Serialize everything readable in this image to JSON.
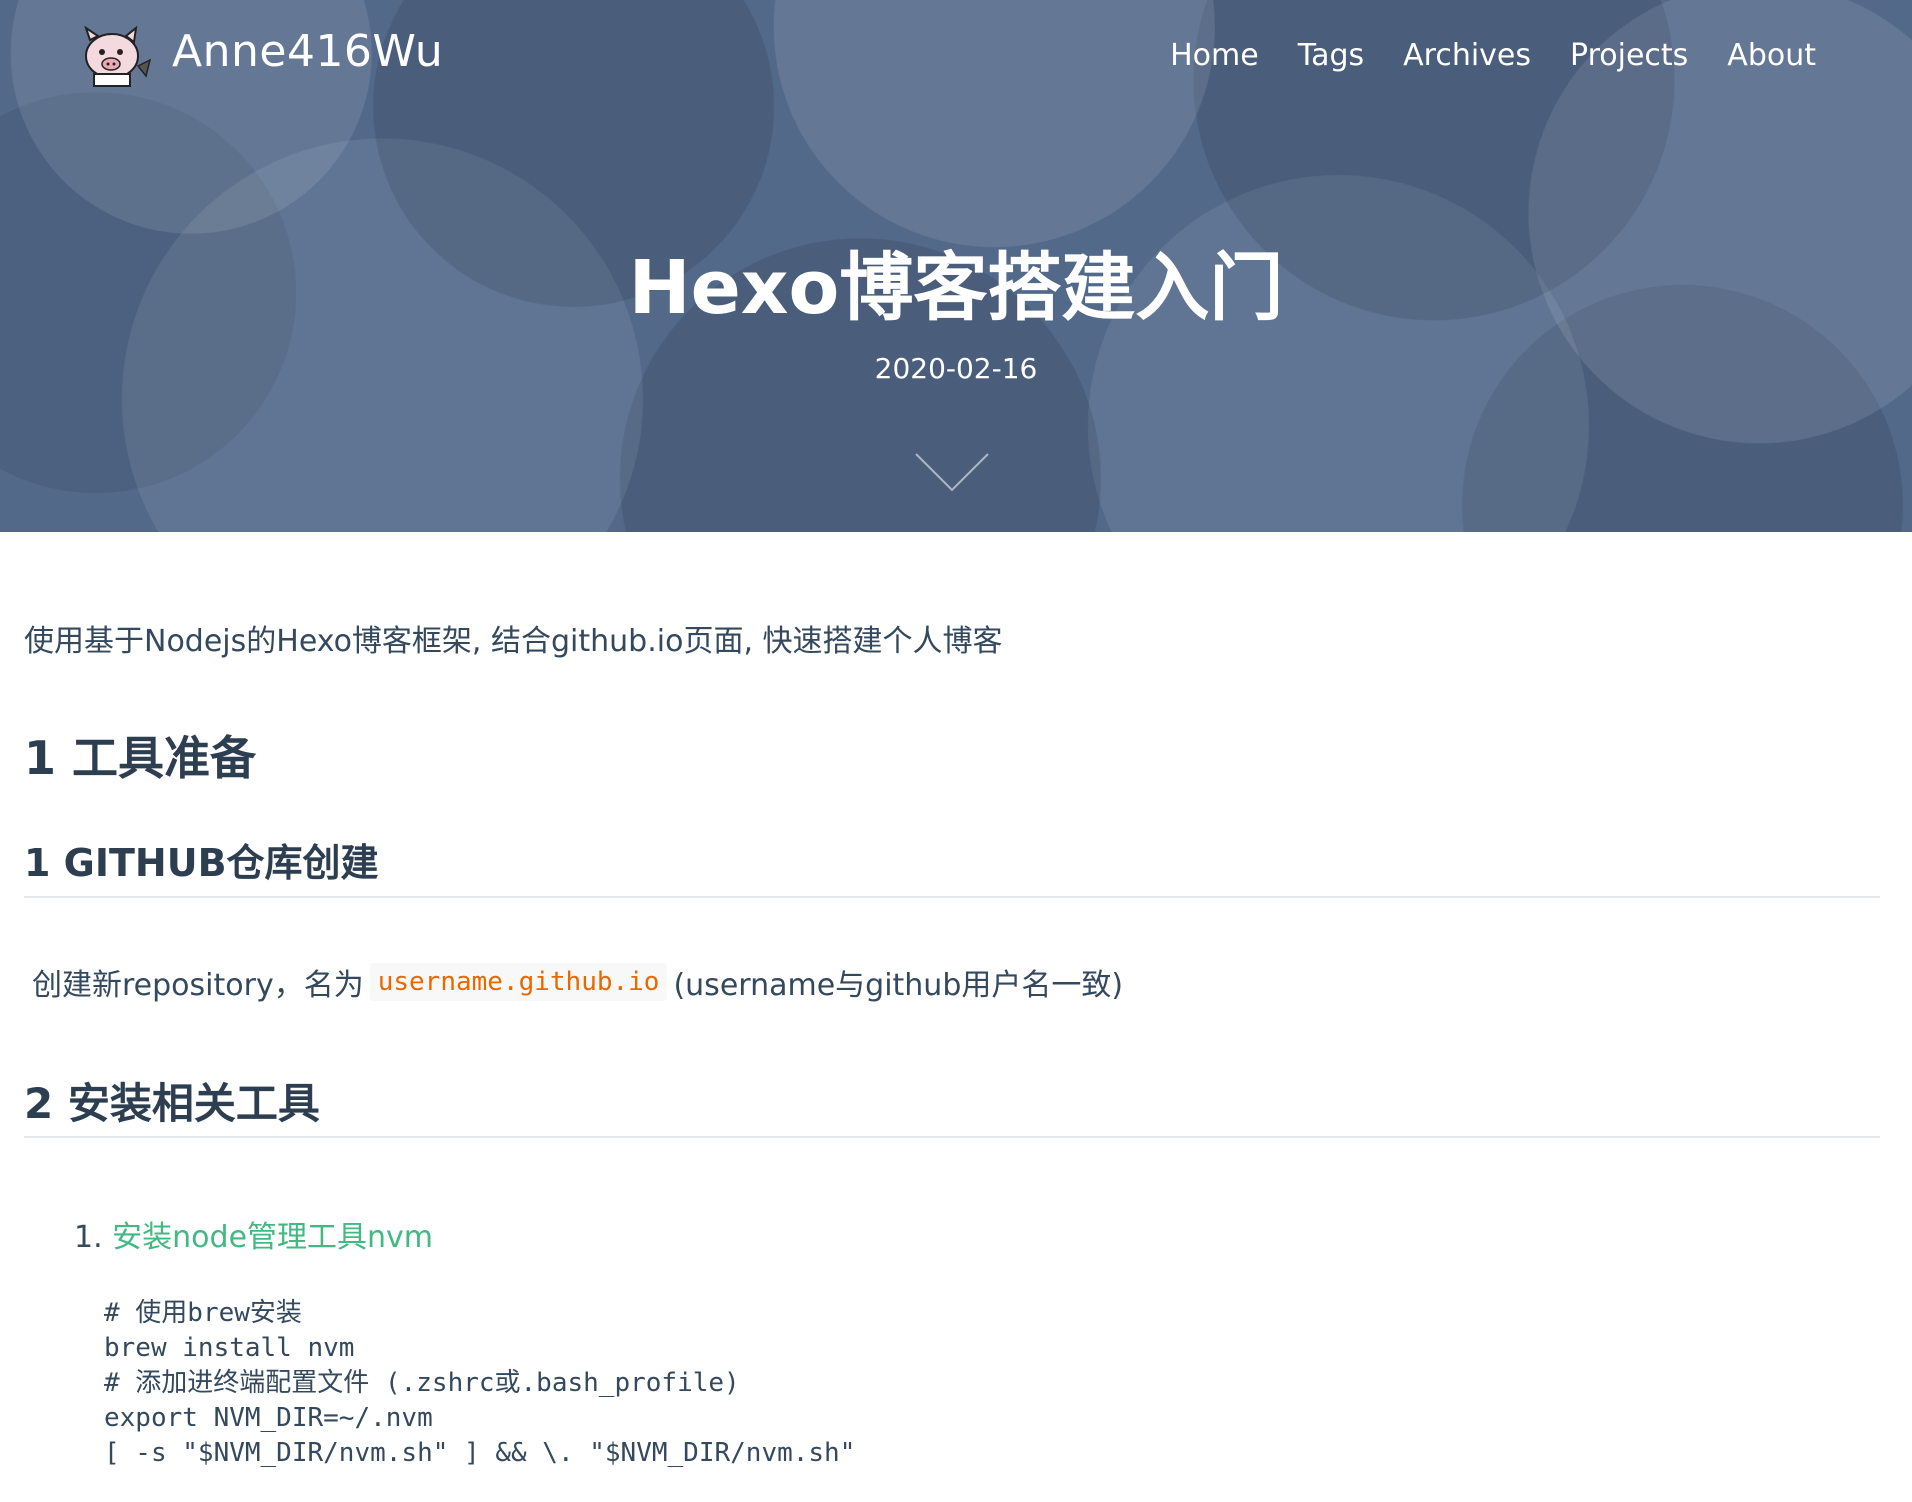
{
  "nav": {
    "brand": "Anne416Wu",
    "menu": [
      "Home",
      "Tags",
      "Archives",
      "Projects",
      "About"
    ]
  },
  "hero": {
    "title": "Hexo博客搭建入门",
    "date": "2020-02-16"
  },
  "article": {
    "intro": "使用基于Nodejs的Hexo博客框架, 结合github.io页面, 快速搭建个人博客",
    "h1": "1 工具准备",
    "section1": {
      "heading": "1 GITHUB仓库创建",
      "para_before": "创建新repository，名为",
      "para_code": "username.github.io",
      "para_after": "(username与github用户名一致)"
    },
    "section2": {
      "heading": "2 安装相关工具",
      "list_number": "1.",
      "list_link": "安装node管理工具nvm",
      "code_lines": [
        "# 使用brew安装",
        "brew install nvm",
        "# 添加进终端配置文件 (.zshrc或.bash_profile)",
        "export NVM_DIR=~/.nvm",
        "[ -s \"$NVM_DIR/nvm.sh\" ] && \\. \"$NVM_DIR/nvm.sh\""
      ]
    }
  },
  "colors": {
    "hero_bg": "#52698a",
    "link_green": "#42b983",
    "inline_code": "#e96900",
    "heading": "#2c3e50"
  }
}
